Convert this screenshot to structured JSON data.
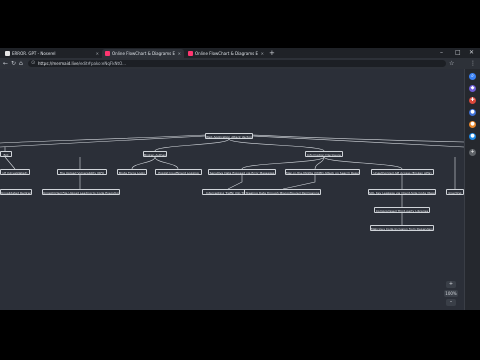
{
  "browser": {
    "tabs": [
      {
        "label": "ERROR. GPT - Noserel",
        "favicon_color": "#e6e6e6",
        "active": false
      },
      {
        "label": "Online FlowChart & Diagrams E",
        "favicon_color": "#ff3670",
        "active": true
      },
      {
        "label": "Online FlowChart & Diagrams E",
        "favicon_color": "#ff3670",
        "active": false
      }
    ],
    "new_tab": "+",
    "window_controls": {
      "minimize": "–",
      "maximize": "□",
      "close": "✕"
    },
    "url_host": "https://mermaid.live",
    "url_path": "/edit#pako:eNqFkNtO...",
    "icons": {
      "back": "←",
      "forward": "→",
      "reload": "↻",
      "home": "⌂",
      "lock": "🔒",
      "star": "☆",
      "extensions": "⋮"
    }
  },
  "sidepanel": {
    "icons": [
      {
        "name": "search-icon",
        "glyph": "⌕",
        "color": "#3b82f6"
      },
      {
        "name": "collections-icon",
        "glyph": "◆",
        "color": "#6b5bd6"
      },
      {
        "name": "tools-icon",
        "glyph": "✚",
        "color": "#d9483b"
      },
      {
        "name": "games-icon",
        "glyph": "●",
        "color": "#3d6fd6"
      },
      {
        "name": "office-icon",
        "glyph": "●",
        "color": "#e8862a"
      },
      {
        "name": "outlook-icon",
        "glyph": "●",
        "color": "#1e88e5"
      },
      {
        "name": "add-icon",
        "glyph": "+",
        "color": "#5f6368"
      }
    ]
  },
  "diagram": {
    "nodes": {
      "root": "Web Application Attack Vectors",
      "n_left_top": "Bot",
      "n_broken_auth": "Broken Authentication",
      "n_info_disclosure": "Information Disclosure",
      "n_left_mid": "Lfi (Unvalidated)",
      "n_file_upload": "File Upload Vulnerability (RFI)",
      "n_brute_force": "Brute Force Login",
      "n_expose_creds": "Exploit Insufficient Logging",
      "n_verbose_errors": "Sensitive Data Exposed via Error Messages",
      "n_mitm": "Man-in-the-Middle (MitM) Attack on Search Results",
      "n_unauth_access": "Unauthorized API Access (Broken APIs)",
      "n_left_far": "Unvalidated Redirects",
      "n_unrestricted": "Unrestricted File Upload Leading to Code Execution",
      "n_intercept": "Intercepting Traffic (No TLS)",
      "n_stealing": "Stealing Data through Misconfigured Permissions",
      "n_sql": "SQL Key Leakage via Client-Side Code (React)",
      "n_compromise": "Compromised Third-party Libraries",
      "n_malicious": "Malicious Code Inclusion from Dependencies",
      "n_right_edge": "Injecting"
    },
    "controls": {
      "zoom_in": "+",
      "zoom_out": "–",
      "zoom_level": "100%"
    }
  }
}
